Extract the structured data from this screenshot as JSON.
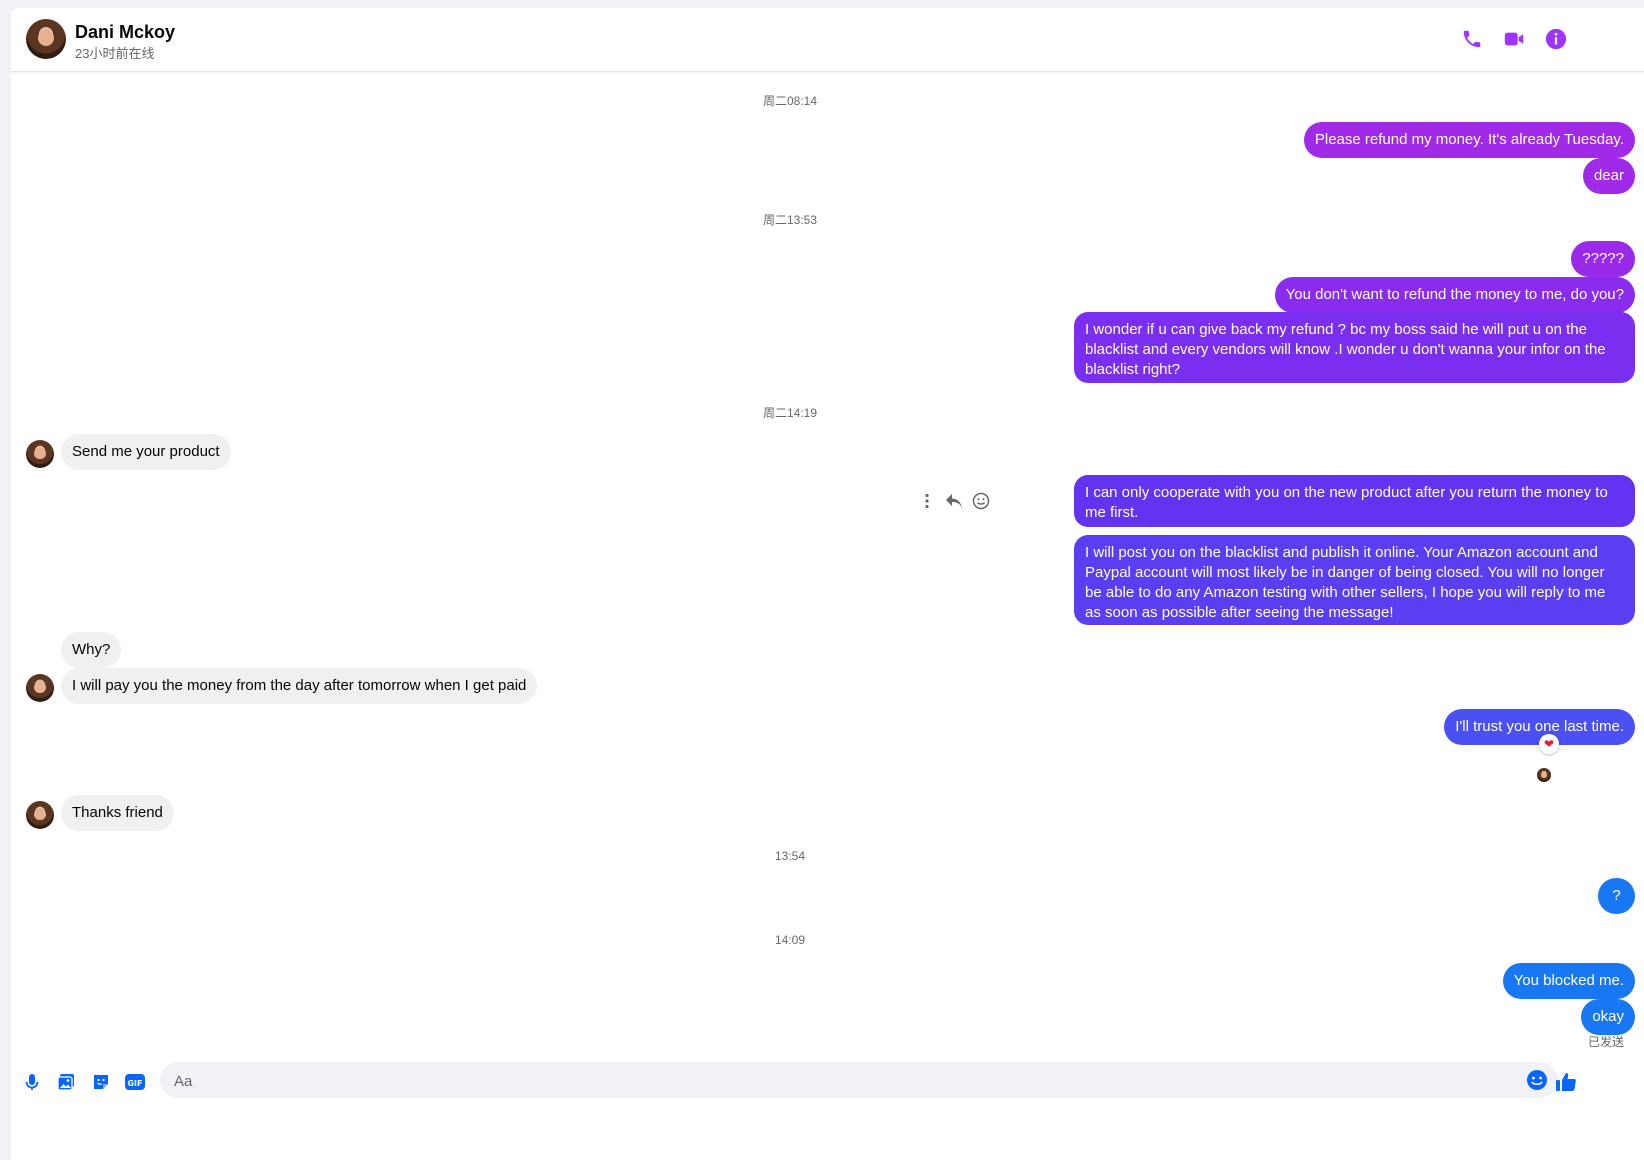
{
  "header": {
    "name": "Dani Mckoy",
    "status": "23小时前在线",
    "accent_color": "#a033ff"
  },
  "timestamps": [
    "周二08:14",
    "周二13:53",
    "周二14:19",
    "13:54",
    "14:09"
  ],
  "messages": {
    "m1": "Please refund my money. It's already Tuesday.",
    "m2": "dear",
    "m3": "?????",
    "m4": "You don't want to refund the money to me, do you?",
    "m5": "I wonder if u can give back my refund ? bc my boss said he will put u on the blacklist and every vendors will know .I wonder u don't wanna your infor on the blacklist right?",
    "m6": "Send me your product",
    "m7": "I can only cooperate with you on the new product after you return the money to me first.",
    "m8": " I will post you on the blacklist and publish it online. Your Amazon account and Paypal account will most likely be in danger of being closed.  You will no longer be able to do any Amazon testing with other sellers, I hope you will reply to me as soon as possible after seeing the message!",
    "m9": "Why?",
    "m10": "I will pay you the money from the day after tomorrow when I get paid",
    "m11": "I'll trust you one last time.",
    "m12": "Thanks friend",
    "m13": "?",
    "m14": "You blocked me.",
    "m15": "okay"
  },
  "reaction": "❤",
  "sent_status": "已发送",
  "composer": {
    "placeholder": "Aa",
    "gif_label": "GIF"
  },
  "bubble_colors": {
    "magenta": "#a129e8",
    "purple": "#7a2ef0",
    "indigo": "#5b3df2",
    "blue_violet": "#4b50f3",
    "blue": "#1877f2",
    "incoming": "#f0f0f0"
  }
}
